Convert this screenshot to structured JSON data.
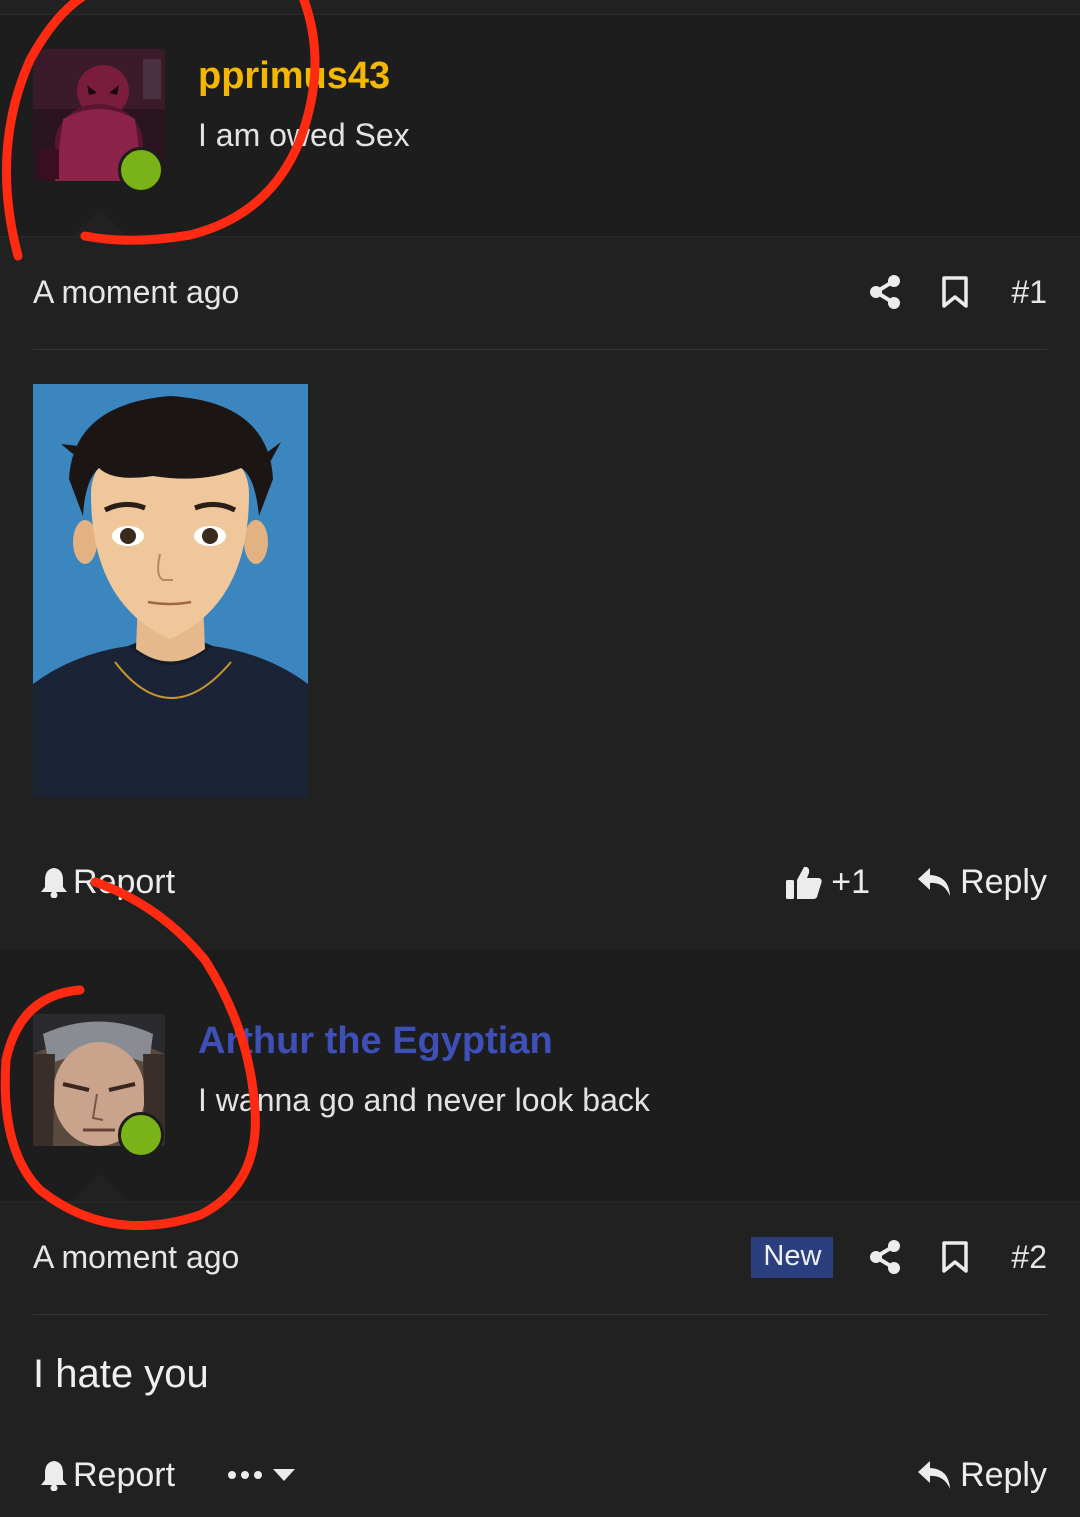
{
  "posts": [
    {
      "username": "pprimus43",
      "username_color": "#f5b800",
      "user_title": "I am owed Sex",
      "time": "A moment ago",
      "post_number": "#1",
      "reaction_count": "+1",
      "report_label": "Report",
      "reply_label": "Reply",
      "online_color": "#7ab317"
    },
    {
      "username": "Arthur the Egyptian",
      "username_color": "#3f4fb8",
      "user_title": "I wanna go and never look back",
      "time": "A moment ago",
      "badge": "New",
      "post_number": "#2",
      "body": "I hate you",
      "report_label": "Report",
      "reply_label": "Reply",
      "online_color": "#7ab317"
    }
  ],
  "icons": {
    "share": "share-icon",
    "bookmark": "bookmark-icon",
    "bell": "bell-icon",
    "like": "thumbs-up-icon",
    "reply": "reply-arrow-icon",
    "more": "ellipsis-icon",
    "dropdown": "caret-down-icon"
  },
  "annotation_color": "#ff2a12"
}
